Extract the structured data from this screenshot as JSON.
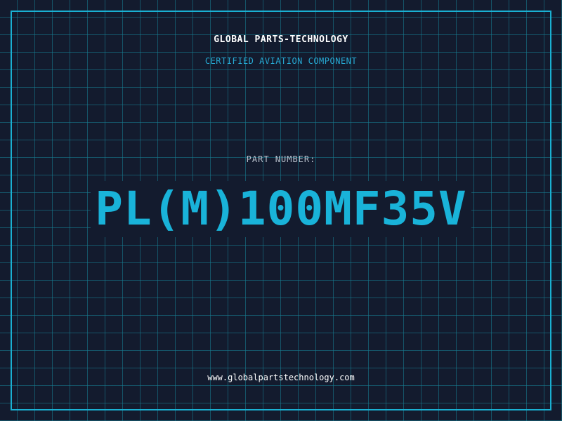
{
  "header": {
    "brand": "GLOBAL PARTS-TECHNOLOGY",
    "tagline": "CERTIFIED AVIATION COMPONENT"
  },
  "part": {
    "label": "PART NUMBER:",
    "number": "PL(M)100MF35V"
  },
  "footer": {
    "url": "www.globalpartstechnology.com"
  },
  "colors": {
    "background": "#131b2e",
    "grid": "#1682a0",
    "accent": "#19b3d9",
    "text": "#ffffff",
    "muted": "#b8c0cc"
  }
}
